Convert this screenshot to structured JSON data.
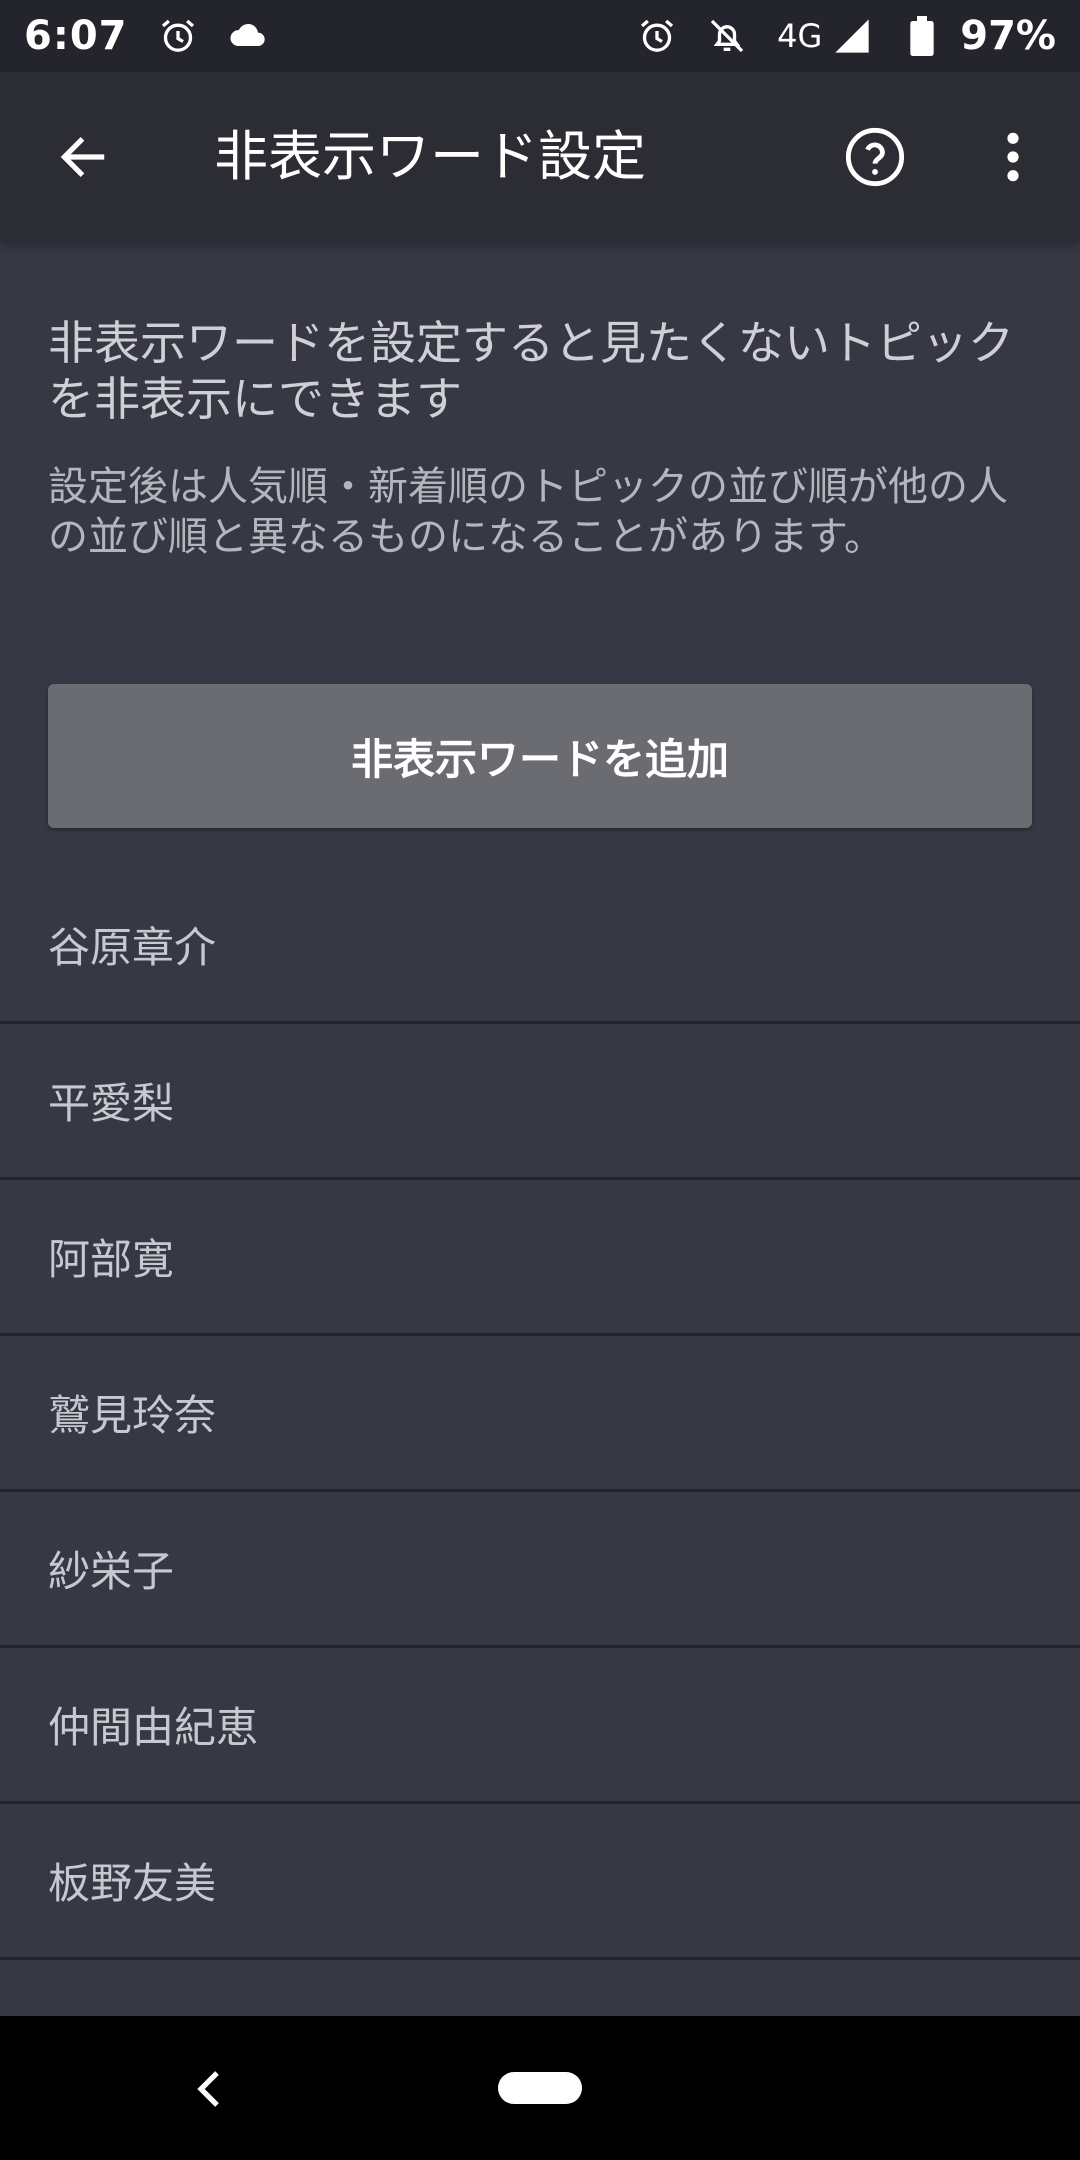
{
  "status_bar": {
    "time": "6:07",
    "network": "4G",
    "battery": "97%",
    "icons": [
      "alarm-icon",
      "cloud-icon",
      "alarm-icon",
      "notifications-off-icon",
      "signal-icon",
      "battery-icon"
    ]
  },
  "app_bar": {
    "title": "非表示ワード設定",
    "back_icon": "arrow-left-icon",
    "help_icon": "help-circle-icon",
    "more_icon": "more-vert-icon"
  },
  "description": {
    "main": "非表示ワードを設定すると見たくないトピックを非表示にできます",
    "sub": "設定後は人気順・新着順のトピックの並び順が他の人の並び順と異なるものになることがあります。"
  },
  "add_button": {
    "label": "非表示ワードを追加"
  },
  "words": [
    {
      "label": "谷原章介"
    },
    {
      "label": "平愛梨"
    },
    {
      "label": "阿部寛"
    },
    {
      "label": "鷲見玲奈"
    },
    {
      "label": "紗栄子"
    },
    {
      "label": "仲間由紀恵"
    },
    {
      "label": "板野友美"
    }
  ],
  "colors": {
    "background": "#383844",
    "app_bar": "#2c2c35",
    "status_bar": "#24242c",
    "button": "#6b6b72",
    "divider": "#24242c",
    "nav_bar": "#000000"
  }
}
